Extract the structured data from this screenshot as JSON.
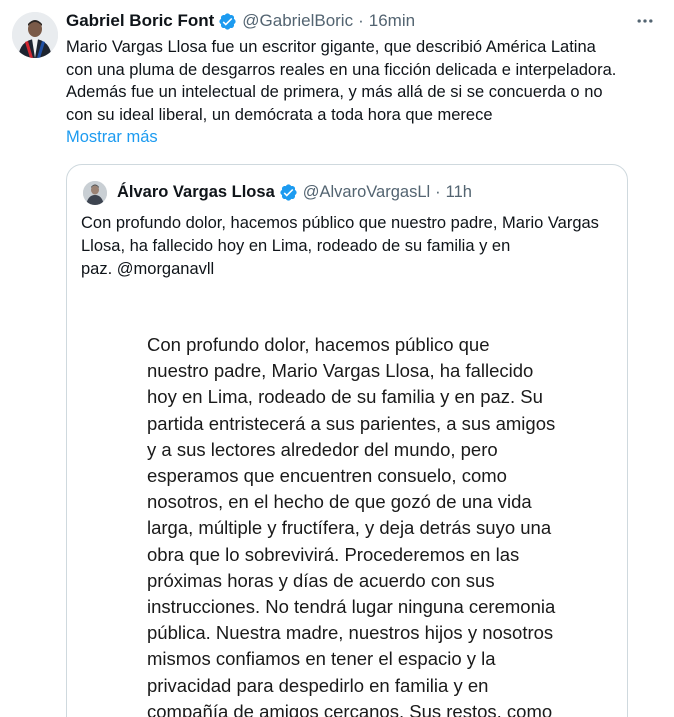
{
  "tweet": {
    "author_name": "Gabriel Boric Font",
    "handle": "@GabrielBoric",
    "separator": "·",
    "time": "16min",
    "more_icon": "more-horizontal-icon",
    "text_lines": [
      "Mario Vargas Llosa fue un escritor gigante, que describió América Latina",
      "con una pluma de desgarros reales en una ficción delicada e interpeladora.",
      "Además fue un intelectual de primera, y más allá de si se concuerda o no",
      "con su ideal liberal, un demócrata a toda hora que merece"
    ],
    "show_more": "Mostrar más",
    "verified_color": "#1d9bf0"
  },
  "quote": {
    "author_name": "Álvaro Vargas Llosa",
    "handle": "@AlvaroVargasLl",
    "separator": "·",
    "time": "11h",
    "text_lines": [
      "Con profundo dolor, hacemos público que nuestro padre, Mario Vargas",
      "Llosa, ha fallecido hoy en Lima, rodeado de su familia y en",
      "paz. @morganavll"
    ],
    "image_text_lines": [
      "Con profundo dolor,  hacemos público que",
      "nuestro padre, Mario Vargas Llosa, ha fallecido",
      "hoy en Lima, rodeado de su familia y en paz. Su",
      "partida entristecerá a sus parientes, a sus amigos",
      "y a sus lectores alrededor del mundo, pero",
      "esperamos que encuentren consuelo, como",
      "nosotros, en el hecho de que gozó de una vida",
      "larga, múltiple y fructífera, y deja detrás suyo una",
      "obra que lo sobrevivirá. Procederemos en las",
      "próximas horas y días de acuerdo con sus",
      "instrucciones. No tendrá lugar ninguna ceremonia",
      "pública. Nuestra madre, nuestros hijos y nosotros",
      "mismos confiamos en tener el espacio y la",
      "privacidad para despedirlo en familia y en",
      "compañía de amigos cercanos. Sus restos, como"
    ]
  }
}
